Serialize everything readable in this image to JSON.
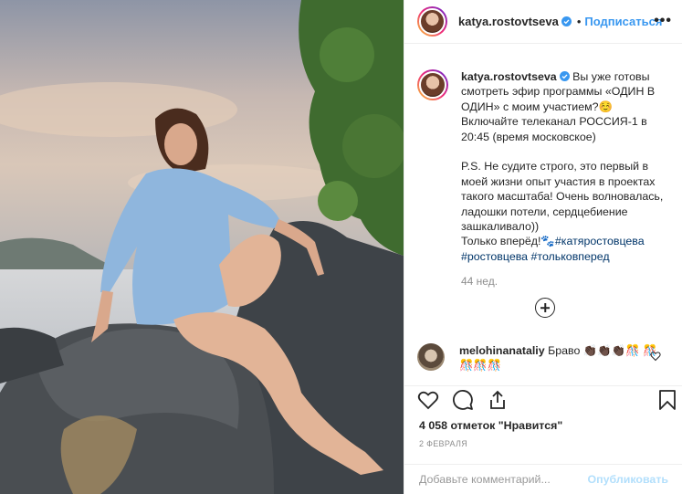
{
  "header": {
    "username": "katya.rostovtseva",
    "separator": "•",
    "follow_label": "Подписаться",
    "more_label": "•••"
  },
  "caption": {
    "username": "katya.rostovtseva",
    "text": "Вы уже готовы смотреть эфир программы «ОДИН В ОДИН» с моим участием?☺️\nВключайте телеканал РОССИЯ-1 в 20:45 (время московское)\n\nP.S. Не судите строго, это первый в моей жизни опыт участия в проектах такого масштаба! Очень волновалась, ладошки потели, сердцебиение зашкаливало))\nТолько вперёд!🐾",
    "hashtags": [
      "#катяростовцева",
      "#ростовцева",
      "#тольковперед"
    ],
    "time_ago": "44 нед."
  },
  "comment": {
    "username": "melohinanataliy",
    "text": "Браво 👏🏿👏🏿👏🏿🎊 🎊🎊🎊🎊"
  },
  "stats": {
    "likes": "4 058 отметок \"Нравится\"",
    "date": "2 ФЕВРАЛЯ"
  },
  "add_comment": {
    "placeholder": "Добавьте комментарий...",
    "publish_label": "Опубликовать"
  },
  "icons": {
    "like": "heart-icon",
    "comment": "comment-icon",
    "share": "share-icon",
    "save": "bookmark-icon",
    "verified": "verified-badge-icon",
    "load_more": "plus-circle-icon"
  },
  "colors": {
    "link": "#3897f0",
    "hashtag": "#003569",
    "muted": "#8e8e8e",
    "border": "#efefef",
    "publish_disabled": "#b2dffc"
  }
}
